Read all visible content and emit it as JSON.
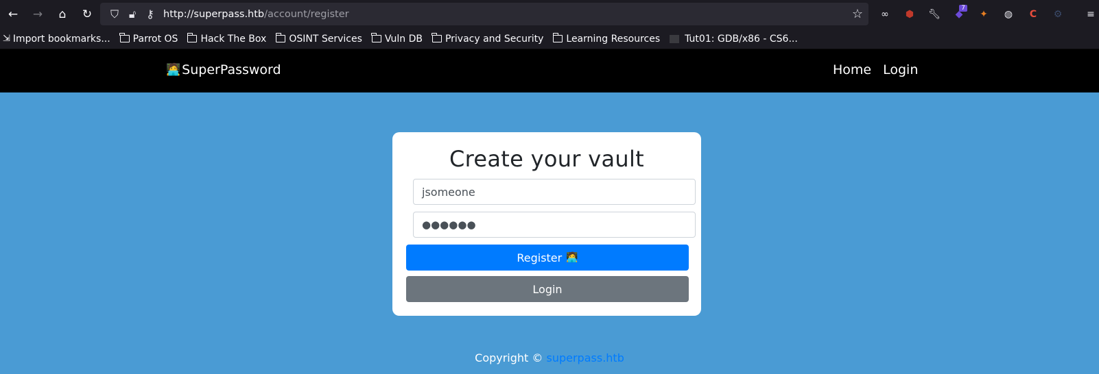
{
  "browser": {
    "url_host": "http://superpass.htb",
    "url_path": "/account/register",
    "extension_badge": "7",
    "bookmarks": [
      "Import bookmarks...",
      "Parrot OS",
      "Hack The Box",
      "OSINT Services",
      "Vuln DB",
      "Privacy and Security",
      "Learning Resources",
      "Tut01: GDB/x86 - CS6..."
    ]
  },
  "site": {
    "brand": "SuperPassword",
    "brand_icon": "🧑‍💻",
    "nav": {
      "home": "Home",
      "login": "Login"
    }
  },
  "form": {
    "title": "Create your vault",
    "username_value": "jsomeone",
    "password_masked": "●●●●●●",
    "register_label": "Register",
    "register_emoji": "🧑‍💻",
    "login_label": "Login"
  },
  "footer": {
    "text": "Copyright © ",
    "link": "superpass.htb"
  },
  "colors": {
    "page_bg": "#4a9bd4",
    "primary": "#007bff",
    "secondary": "#6c757d",
    "navbar": "#000000"
  }
}
